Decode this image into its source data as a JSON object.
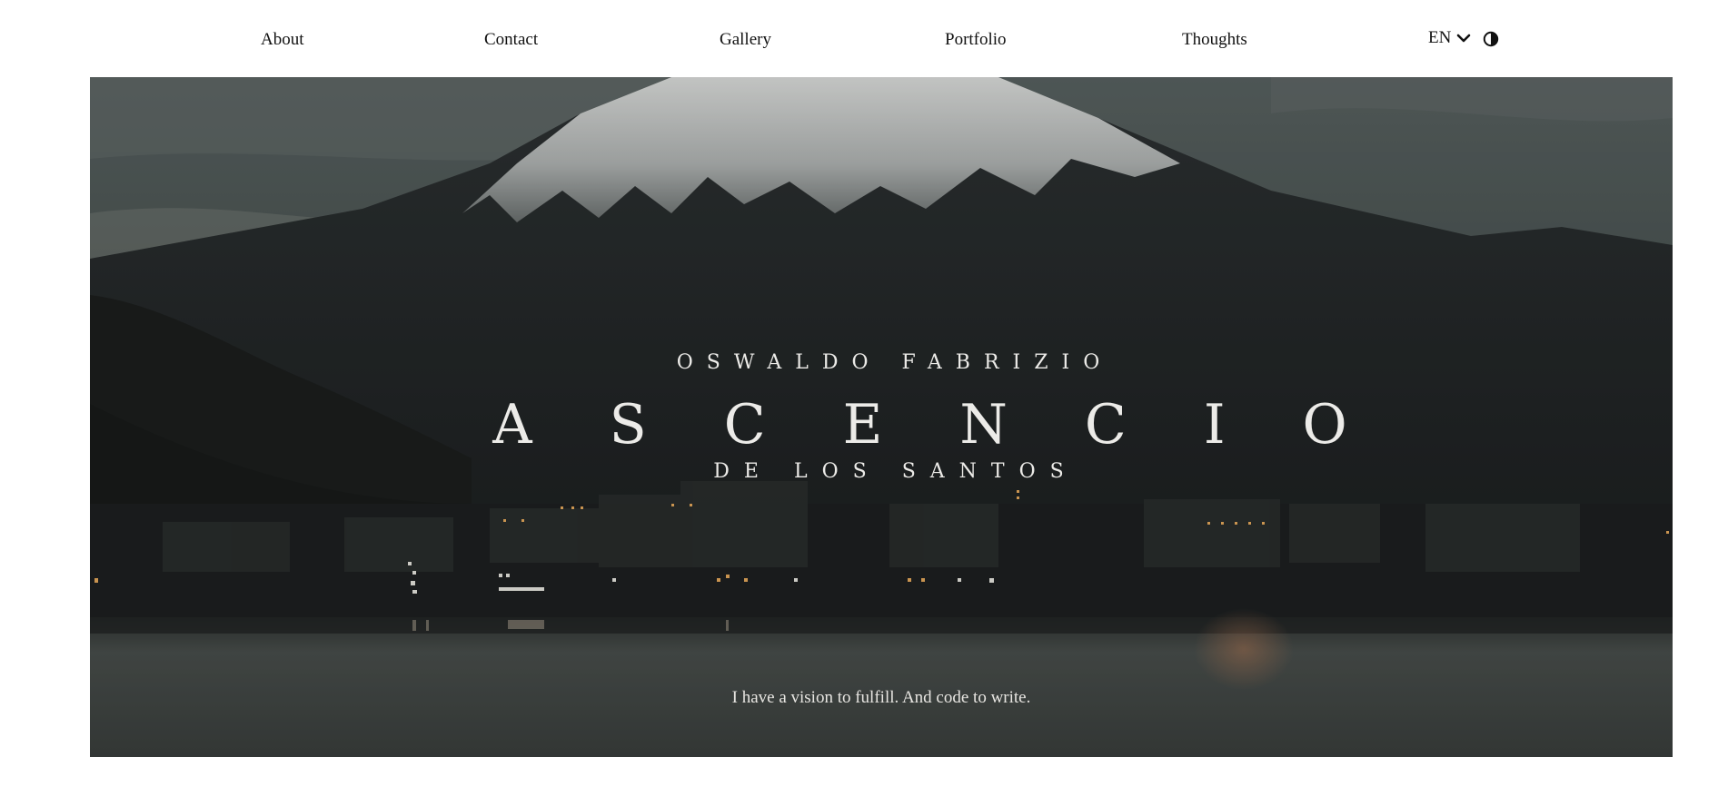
{
  "nav": {
    "items": [
      {
        "label": "About"
      },
      {
        "label": "Contact"
      },
      {
        "label": "Gallery"
      },
      {
        "label": "Portfolio"
      },
      {
        "label": "Thoughts"
      }
    ],
    "language": {
      "label": "EN",
      "icon": "chevron-down-icon"
    },
    "theme_toggle": {
      "icon": "contrast-icon"
    }
  },
  "hero": {
    "first_name": "OSWALDO FABRIZIO",
    "last_name": "ASCENCIO",
    "suffix_name": "DE LOS SANTOS",
    "tagline": "I have a vision to fulfill. And code to write."
  },
  "colors": {
    "page_background": "#ffffff",
    "nav_text": "#111111",
    "hero_text": "#ecebe8"
  }
}
